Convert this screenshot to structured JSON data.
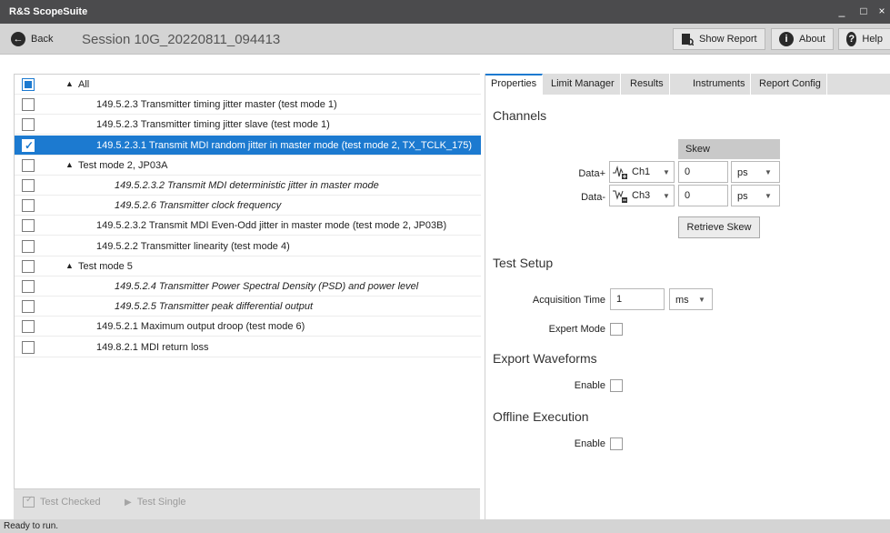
{
  "app": {
    "title": "R&S ScopeSuite"
  },
  "window_controls": {
    "minimize": "_",
    "maximize": "□",
    "close": "×"
  },
  "toolbar": {
    "back_label": "Back",
    "session_title": "Session  10G_20220811_094413",
    "show_report_label": "Show Report",
    "about_label": "About",
    "help_label": "Help"
  },
  "tree": {
    "rows": [
      {
        "label": "All",
        "checked": "partial",
        "expander": "▲",
        "italic": false
      },
      {
        "label": "149.5.2.3 Transmitter timing jitter master (test mode 1)",
        "checked": false,
        "italic": false
      },
      {
        "label": "149.5.2.3 Transmitter timing jitter slave (test mode 1)",
        "checked": false,
        "italic": false
      },
      {
        "label": "149.5.2.3.1 Transmit MDI random jitter in master mode (test mode 2, TX_TCLK_175)",
        "checked": true,
        "selected": true,
        "italic": false
      },
      {
        "label": "Test mode 2, JP03A",
        "checked": false,
        "expander": "▲",
        "italic": false
      },
      {
        "label": "149.5.2.3.2 Transmit MDI deterministic jitter in master mode",
        "checked": false,
        "italic": true
      },
      {
        "label": "149.5.2.6 Transmitter clock frequency",
        "checked": false,
        "italic": true
      },
      {
        "label": "149.5.2.3.2 Transmit MDI Even-Odd jitter in master mode (test mode 2, JP03B)",
        "checked": false,
        "italic": false
      },
      {
        "label": "149.5.2.2 Transmitter linearity (test mode 4)",
        "checked": false,
        "italic": false
      },
      {
        "label": "Test mode 5",
        "checked": false,
        "expander": "▲",
        "italic": false
      },
      {
        "label": "149.5.2.4 Transmitter Power Spectral Density (PSD) and power level",
        "checked": false,
        "italic": true
      },
      {
        "label": "149.5.2.5 Transmitter peak differential output",
        "checked": false,
        "italic": true
      },
      {
        "label": "149.5.2.1 Maximum output droop (test mode 6)",
        "checked": false,
        "italic": false
      },
      {
        "label": "149.8.2.1 MDI return loss",
        "checked": false,
        "italic": false
      }
    ]
  },
  "left_bottom": {
    "test_checked_label": "Test Checked",
    "test_single_label": "Test Single"
  },
  "tabs": [
    "Properties",
    "Limit Manager",
    "Results",
    "Instruments",
    "Report Config"
  ],
  "properties": {
    "channels_title": "Channels",
    "skew_header": "Skew",
    "data_plus": {
      "label": "Data+",
      "channel": "Ch1",
      "skew": "0",
      "unit": "ps"
    },
    "data_minus": {
      "label": "Data-",
      "channel": "Ch3",
      "skew": "0",
      "unit": "ps"
    },
    "retrieve_skew_label": "Retrieve Skew",
    "test_setup_title": "Test Setup",
    "acq_time_label": "Acquisition Time",
    "acq_time_value": "1",
    "acq_time_unit": "ms",
    "expert_mode_label": "Expert Mode",
    "export_waveforms_title": "Export Waveforms",
    "export_enable_label": "Enable",
    "offline_execution_title": "Offline Execution",
    "offline_enable_label": "Enable"
  },
  "status": {
    "text": "Ready to run."
  },
  "colors": {
    "accent": "#1c7ad0",
    "titlebar": "#4b4b4d",
    "toolbar": "#d4d4d4"
  }
}
